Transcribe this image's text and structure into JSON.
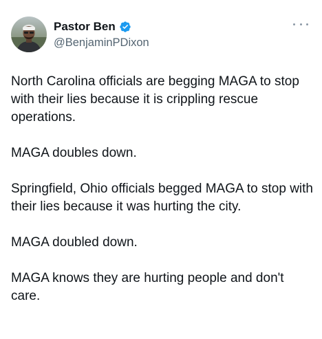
{
  "tweet": {
    "author": {
      "display_name": "Pastor Ben",
      "handle": "@BenjaminPDixon",
      "verified": true,
      "avatar_icon": "profile-photo",
      "verified_color": "#1d9bf0"
    },
    "more_icon": "more-horizontal-icon",
    "paragraphs": [
      "North Carolina officials are begging MAGA to stop with their lies because it is crippling rescue operations.",
      "MAGA doubles down.",
      "Springfield, Ohio officials begged MAGA to stop with their lies because it was hurting the city.",
      "MAGA doubled down.",
      "MAGA knows they are hurting people and don't care."
    ]
  }
}
